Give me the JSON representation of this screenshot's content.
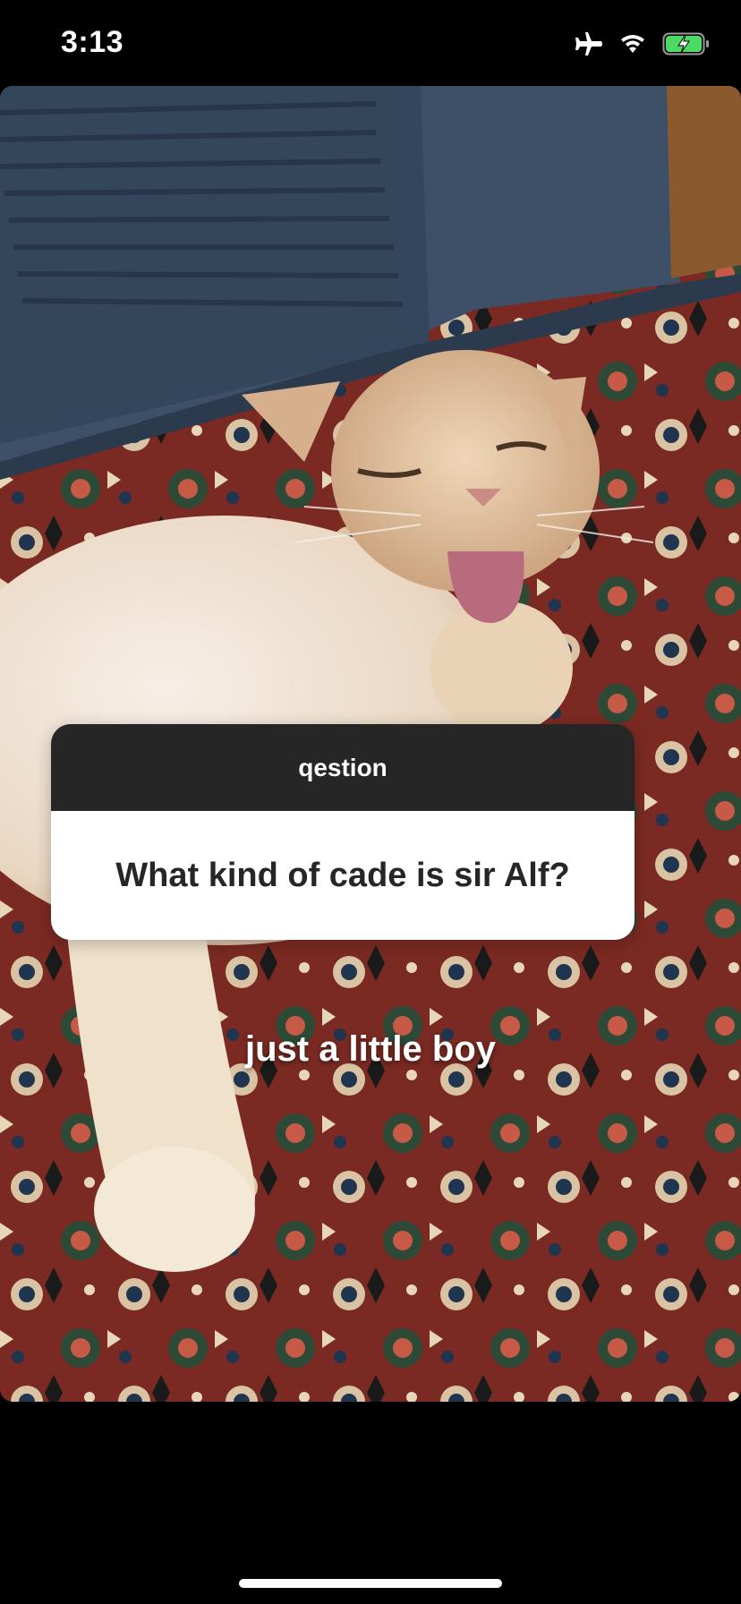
{
  "status_bar": {
    "time": "3:13",
    "icons": [
      "airplane-icon",
      "wifi-icon",
      "battery-charging-icon"
    ],
    "battery_color": "#4cd964"
  },
  "story": {
    "photo_description_icon": "cat-photo",
    "question_sticker": {
      "header": "qestion",
      "question": "What kind of cade is sir Alf?"
    },
    "answer_text": "just a little boy"
  },
  "colors": {
    "sticker_header_bg": "#262626",
    "sticker_body_bg": "#ffffff",
    "door_blue": "#3d5068",
    "rug_red": "#7a2a22"
  }
}
